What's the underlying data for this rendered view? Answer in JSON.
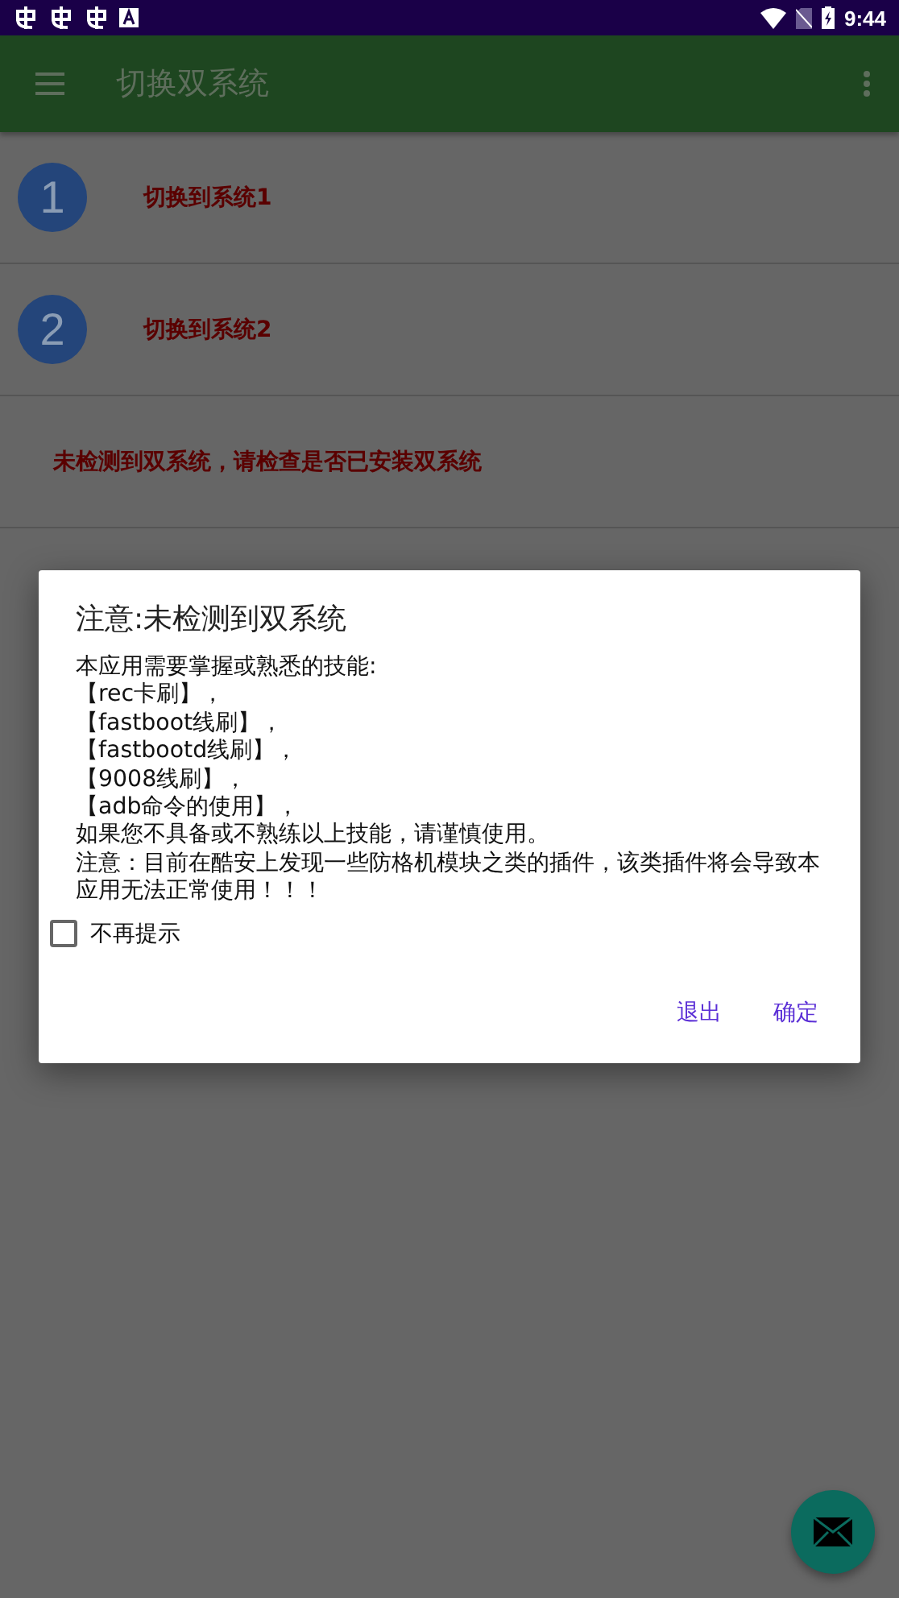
{
  "status_bar": {
    "time": "9:44"
  },
  "app_bar": {
    "title": "切换双系统"
  },
  "items": [
    {
      "number": "1",
      "label": "切换到系统1"
    },
    {
      "number": "2",
      "label": "切换到系统2"
    }
  ],
  "notice": "未检测到双系统，请检查是否已安装双系统",
  "dialog": {
    "title": "注意:未检测到双系统",
    "message_lines": [
      "本应用需要掌握或熟悉的技能:",
      "【rec卡刷】，",
      "【fastboot线刷】，",
      "【fastbootd线刷】，",
      "【9008线刷】，",
      "【adb命令的使用】，",
      "如果您不具备或不熟练以上技能，请谨慎使用。",
      "注意：目前在酷安上发现一些防格机模块之类的插件，该类插件将会导致本应用无法正常使用！！！"
    ],
    "checkbox": {
      "label": "不再提示",
      "checked": false
    },
    "buttons": [
      "退出",
      "确定"
    ]
  }
}
